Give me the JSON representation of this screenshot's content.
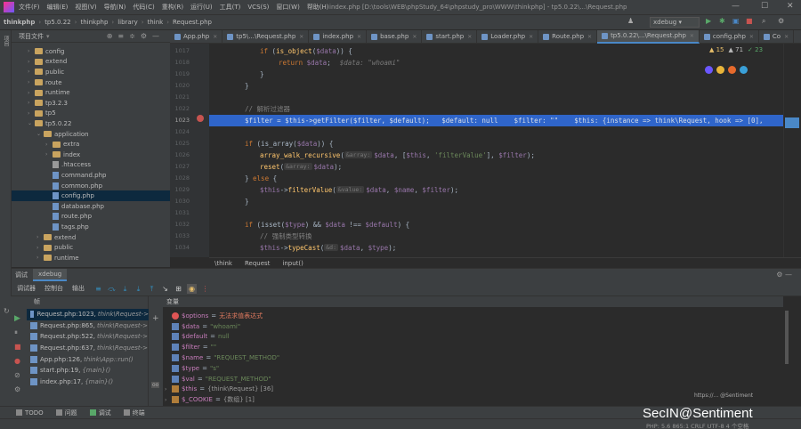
{
  "menu": {
    "items": [
      "文件(F)",
      "编辑(E)",
      "视图(V)",
      "导航(N)",
      "代码(C)",
      "重构(R)",
      "运行(U)",
      "工具(T)",
      "VCS(S)",
      "窗口(W)",
      "帮助(H)"
    ],
    "window_title": "index.php [D:\\tools\\WEB\\phpStudy_64\\phpstudy_pro\\WWW\\thinkphp] - tp5.0.22\\...\\Request.php",
    "minimize": "—",
    "maximize": "☐",
    "close": "✕"
  },
  "nav": {
    "crumbs": [
      "thinkphp",
      "tp5.0.22",
      "thinkphp",
      "library",
      "think",
      "Request.php"
    ],
    "run_config": "xdebug"
  },
  "left_strip": {
    "project_label": "项目",
    "structure_label": "结构",
    "favorites_label": "收藏"
  },
  "project": {
    "header": "项目文件",
    "items": [
      {
        "label": "config",
        "type": "folder",
        "depth": 1,
        "expand": "›"
      },
      {
        "label": "extend",
        "type": "folder",
        "depth": 1,
        "expand": "›"
      },
      {
        "label": "public",
        "type": "folder",
        "depth": 1,
        "expand": "›"
      },
      {
        "label": "route",
        "type": "folder",
        "depth": 1,
        "expand": "›"
      },
      {
        "label": "runtime",
        "type": "folder",
        "depth": 1,
        "expand": "›"
      },
      {
        "label": "tp3.2.3",
        "type": "folder",
        "depth": 1,
        "expand": "›"
      },
      {
        "label": "tp5",
        "type": "folder",
        "depth": 1,
        "expand": "›"
      },
      {
        "label": "tp5.0.22",
        "type": "folder",
        "depth": 1,
        "expand": "⌄"
      },
      {
        "label": "application",
        "type": "folder",
        "depth": 2,
        "expand": "⌄"
      },
      {
        "label": "extra",
        "type": "folder",
        "depth": 3,
        "expand": "›"
      },
      {
        "label": "index",
        "type": "folder",
        "depth": 3,
        "expand": "›"
      },
      {
        "label": ".htaccess",
        "type": "ht",
        "depth": 3,
        "expand": ""
      },
      {
        "label": "command.php",
        "type": "file",
        "depth": 3,
        "expand": ""
      },
      {
        "label": "common.php",
        "type": "file",
        "depth": 3,
        "expand": ""
      },
      {
        "label": "config.php",
        "type": "file",
        "depth": 3,
        "expand": "",
        "selected": true
      },
      {
        "label": "database.php",
        "type": "file",
        "depth": 3,
        "expand": ""
      },
      {
        "label": "route.php",
        "type": "file",
        "depth": 3,
        "expand": ""
      },
      {
        "label": "tags.php",
        "type": "file",
        "depth": 3,
        "expand": ""
      },
      {
        "label": "extend",
        "type": "folder",
        "depth": 2,
        "expand": "›"
      },
      {
        "label": "public",
        "type": "folder",
        "depth": 2,
        "expand": "›"
      },
      {
        "label": "runtime",
        "type": "folder",
        "depth": 2,
        "expand": "›"
      }
    ]
  },
  "tabs": [
    "App.php",
    "tp5\\...\\Request.php",
    "index.php",
    "base.php",
    "start.php",
    "Loader.php",
    "Route.php",
    "tp5.0.22\\...\\Request.php",
    "config.php",
    "Co"
  ],
  "active_tab_index": 7,
  "inspections": {
    "warnings": "▲ 15",
    "weak": "▲ 71",
    "typos": "✓ 23"
  },
  "line_numbers": [
    "1017",
    "1018",
    "1019",
    "1020",
    "1021",
    "1022",
    "1023",
    "1024",
    "1025",
    "1026",
    "1027",
    "1028",
    "1029",
    "1030",
    "1031",
    "1032",
    "1033",
    "1034"
  ],
  "code": {
    "l1017": {
      "kw": "if",
      "a": " (",
      "fn": "is_object",
      "b": "(",
      "v": "$data",
      "c": ")) {"
    },
    "l1018": {
      "kw": "return",
      "v": " $data",
      "c": ";",
      "dbg": "$data: \"whoami\""
    },
    "l1019": "}",
    "l1020": "}",
    "l1022": "// 解析过滤器",
    "l1023": "$filter = $this->getFilter($filter, $default);   $default: null    $filter: \"\"    $this: {instance => think\\Request, hook => [0],",
    "l1025": {
      "kw": "if",
      "a": " (is_array(",
      "v": "$data",
      "c": ")) {"
    },
    "l1026": {
      "fn": "array_walk_recursive",
      "hint": "&array:",
      "v1": "$data",
      "a": ", [",
      "v2": "$this",
      "s": "'filterValue'",
      "b": "], ",
      "v3": "$filter",
      "c": ");"
    },
    "l1027": {
      "fn": "reset",
      "hint": "&array:",
      "v": "$data",
      "c": ");"
    },
    "l1028": {
      "a": "} ",
      "kw": "else",
      "b": " {"
    },
    "l1029": {
      "v": "$this",
      "a": "->",
      "fn": "filterValue",
      "hint": "&value:",
      "v1": "$data",
      "b": ", ",
      "v2": "$name",
      "c": ", ",
      "v3": "$filter",
      "d": ");"
    },
    "l1030": "}",
    "l1032": {
      "kw": "if",
      "a": " (isset(",
      "v1": "$type",
      "b": ") && ",
      "v2": "$data",
      "c": " !== ",
      "v3": "$default",
      "d": ") {"
    },
    "l1033": "// 强制类型转换",
    "l1034": {
      "v": "$this",
      "a": "->",
      "fn": "typeCast",
      "hint": "&d:",
      "v1": "$data",
      "b": ", ",
      "v2": "$type",
      "c": ");"
    }
  },
  "breadcrumb": [
    "\\think",
    "Request",
    "input()"
  ],
  "debug": {
    "title": "调试",
    "session": "xdebug",
    "tabs": [
      "调试器",
      "控制台",
      "输出"
    ],
    "frames_header": "帧",
    "vars_header": "变量",
    "frames": [
      {
        "file": "Request.php:1023,",
        "ctx": "think\\Request->"
      },
      {
        "file": "Request.php:865,",
        "ctx": "think\\Request->"
      },
      {
        "file": "Request.php:522,",
        "ctx": "think\\Request->"
      },
      {
        "file": "Request.php:637,",
        "ctx": "think\\Request->"
      },
      {
        "file": "App.php:126,",
        "ctx": "think\\App::run()"
      },
      {
        "file": "start.php:19,",
        "ctx": "{main}()"
      },
      {
        "file": "index.php:17,",
        "ctx": "{main}()"
      }
    ],
    "variables": [
      {
        "name": "$options",
        "eq": "=",
        "val": "无法求值表达式",
        "kind": "err",
        "expand": ""
      },
      {
        "name": "$data",
        "eq": "=",
        "val": "\"whoami\"",
        "kind": "str",
        "expand": ""
      },
      {
        "name": "$default",
        "eq": "=",
        "val": "null",
        "kind": "str",
        "expand": ""
      },
      {
        "name": "$filter",
        "eq": "=",
        "val": "\"\"",
        "kind": "str",
        "expand": ""
      },
      {
        "name": "$name",
        "eq": "=",
        "val": "\"REQUEST_METHOD\"",
        "kind": "str",
        "expand": ""
      },
      {
        "name": "$type",
        "eq": "=",
        "val": "\"s\"",
        "kind": "str",
        "expand": ""
      },
      {
        "name": "$val",
        "eq": "=",
        "val": "\"REQUEST_METHOD\"",
        "kind": "str",
        "expand": ""
      },
      {
        "name": "$this",
        "eq": "=",
        "val": "{think\\Request} [36]",
        "kind": "obj",
        "expand": "›"
      },
      {
        "name": "$_COOKIE",
        "eq": "=",
        "val": "{数组} [1]",
        "kind": "obj",
        "expand": "›"
      }
    ]
  },
  "bottom_tabs": [
    "TODO",
    "问题",
    "调试",
    "终端"
  ],
  "status": "PHP: 5.6   865:1   CRLF   UTF-8   4 个空格",
  "watermark": "SecIN@Sentiment",
  "watermark_small": "https://... @Sentiment"
}
